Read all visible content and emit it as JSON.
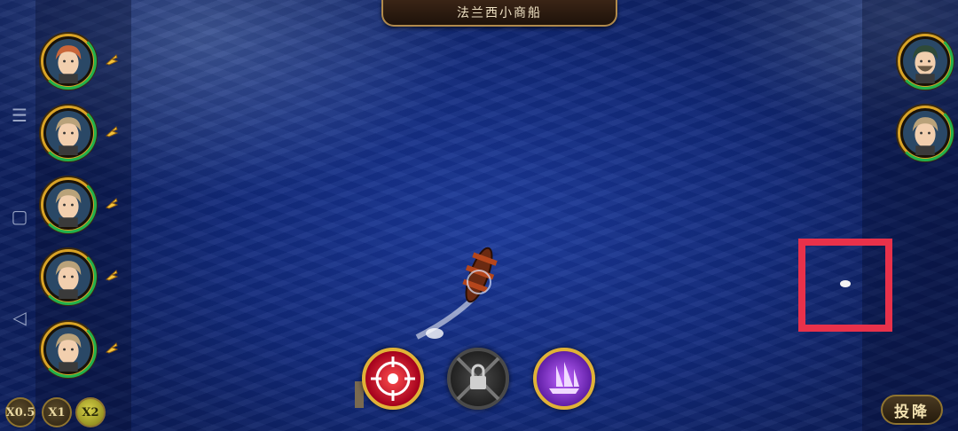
{
  "hud": {
    "title": "法兰西小商船"
  },
  "player_crew": [
    {
      "portrait": "female-officer-portrait",
      "status_icon": "fire-icon"
    },
    {
      "portrait": "male-officer-portrait",
      "status_icon": "fire-icon"
    },
    {
      "portrait": "male-officer-portrait",
      "status_icon": "fire-icon"
    },
    {
      "portrait": "male-officer-portrait",
      "status_icon": "fire-icon"
    },
    {
      "portrait": "male-officer-portrait",
      "status_icon": "fire-icon"
    }
  ],
  "enemy_crew": [
    {
      "portrait": "bearded-captain-portrait"
    },
    {
      "portrait": "male-officer-portrait"
    }
  ],
  "skills": [
    {
      "name": "target-crosshair-skill",
      "icon": "crosshair-icon",
      "color": "#c8102e"
    },
    {
      "name": "chain-lock-skill",
      "icon": "lock-icon",
      "color": "#3a3a3a",
      "locked": true
    },
    {
      "name": "ship-summon-skill",
      "icon": "ship-icon",
      "color": "#7a2fc8"
    }
  ],
  "speed_controls": {
    "options": [
      "X0.5",
      "X1",
      "X2"
    ],
    "selected": "X2"
  },
  "surrender_label": "投降",
  "colors": {
    "sea": "#152f86",
    "gold_frame": "#d9a326",
    "health": "#22b14c",
    "highlight": "#e8314a"
  }
}
